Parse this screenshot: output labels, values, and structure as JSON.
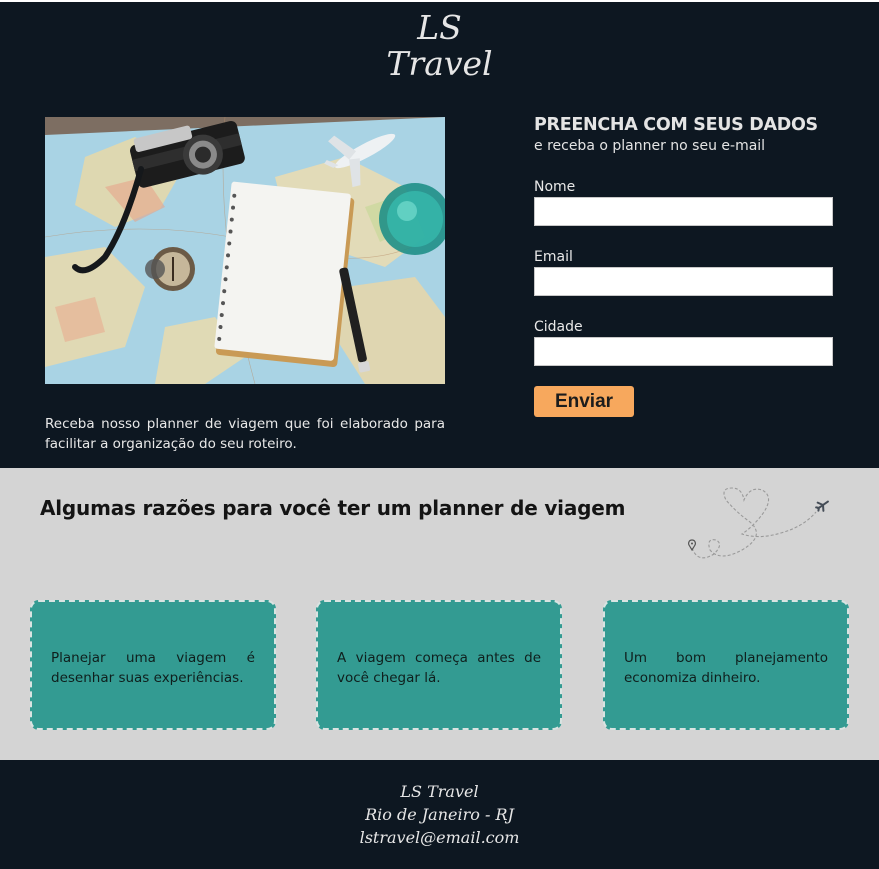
{
  "header": {
    "logo_line1": "LS",
    "logo_line2": "Travel"
  },
  "hero": {
    "image_alt": "travel flat lay with map, camera, notebook, compass, pen, airplane and glass",
    "intro_text": "Receba nosso planner de viagem que foi elaborado para facilitar a organização do seu roteiro."
  },
  "form": {
    "title": "PREENCHA COM SEUS DADOS",
    "subtitle": "e receba o planner no seu e-mail",
    "fields": [
      {
        "label": "Nome",
        "value": "",
        "placeholder": ""
      },
      {
        "label": "Email",
        "value": "",
        "placeholder": ""
      },
      {
        "label": "Cidade",
        "value": "",
        "placeholder": ""
      }
    ],
    "submit_label": "Enviar"
  },
  "reasons": {
    "title": "Algumas razões para você ter um planner de viagem",
    "cards": [
      {
        "text": "Planejar uma viagem é desenhar suas experiências."
      },
      {
        "text": "A viagem começa antes de você chegar lá."
      },
      {
        "text": "Um bom planejamento economiza dinheiro."
      }
    ]
  },
  "footer": {
    "brand": "LS Travel",
    "location": "Rio de Janeiro - RJ",
    "email": "lstravel@email.com"
  },
  "colors": {
    "dark_bg": "#0d1721",
    "light_bg": "#d4d4d4",
    "card_teal": "#339b92",
    "button_orange": "#f7a85d"
  },
  "icons": [
    "heart-trail-airplane-icon",
    "location-pin-icon",
    "airplane-icon"
  ]
}
